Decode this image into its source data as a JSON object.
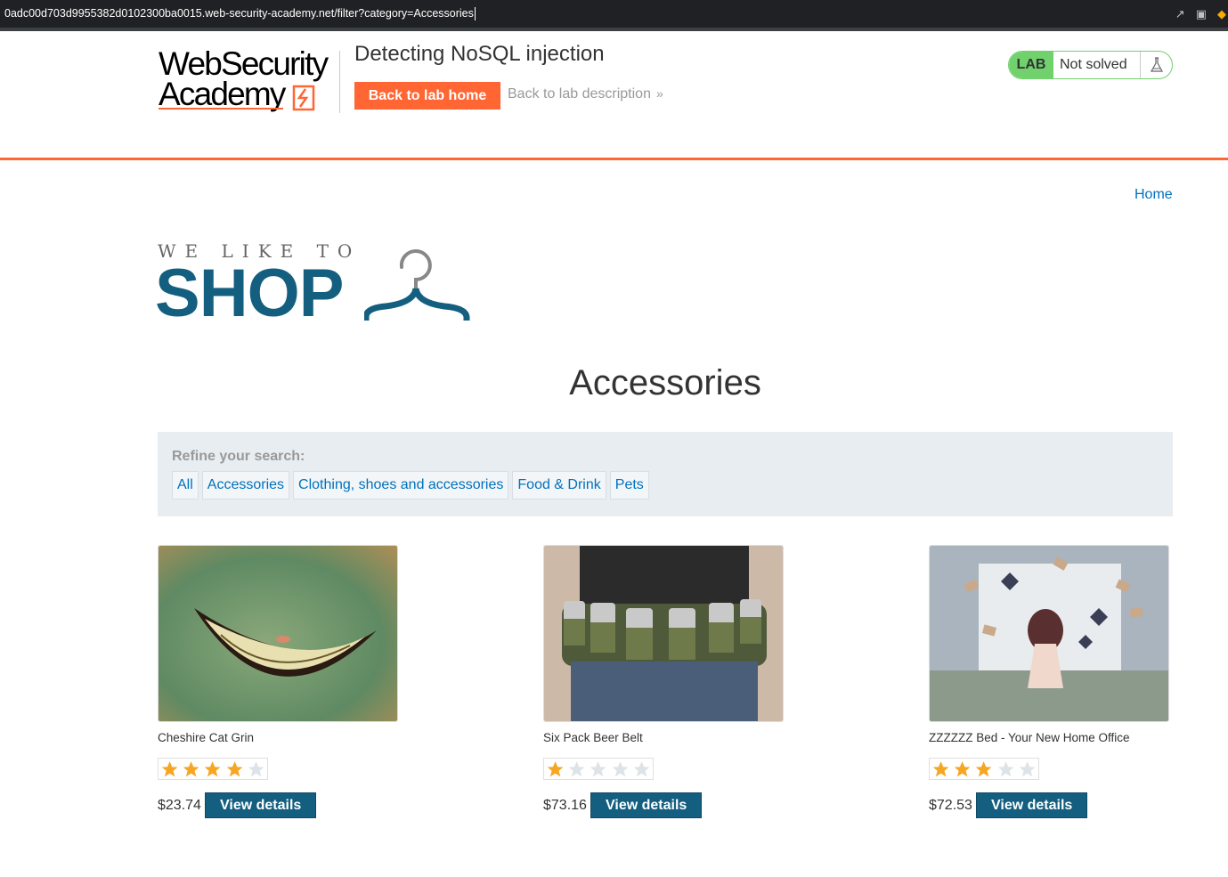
{
  "browser": {
    "url": "0adc00d703d9955382d0102300ba0015.web-security-academy.net/filter?category=Accessories"
  },
  "lab_header": {
    "logo_line1": "WebSecurity",
    "logo_line2": "Academy",
    "title": "Detecting NoSQL injection",
    "back_home_label": "Back to lab home",
    "back_desc_label": "Back to lab description",
    "lab_badge": "LAB",
    "status": "Not solved",
    "colors": {
      "accent": "#ff6633",
      "solved_green": "#70d16d"
    }
  },
  "nav": {
    "home_label": "Home"
  },
  "shop_logo": {
    "tagline": "WE LIKE TO",
    "word": "SHOP"
  },
  "page": {
    "heading": "Accessories"
  },
  "filter": {
    "label": "Refine your search:",
    "categories": [
      "All",
      "Accessories",
      "Clothing, shoes and accessories",
      "Food & Drink",
      "Pets"
    ]
  },
  "products": [
    {
      "name": "Cheshire Cat Grin",
      "rating": 4,
      "price": "$23.74",
      "button": "View details"
    },
    {
      "name": "Six Pack Beer Belt",
      "rating": 1,
      "price": "$73.16",
      "button": "View details"
    },
    {
      "name": "ZZZZZZ Bed - Your New Home Office",
      "rating": 3,
      "price": "$72.53",
      "button": "View details"
    }
  ],
  "icons": [
    "share-icon",
    "camera-icon",
    "shield-icon",
    "flask-icon",
    "chevron-double-right-icon",
    "hanger-icon",
    "star-icon"
  ],
  "colors": {
    "link": "#0071bc",
    "primary_button": "#145f80",
    "filter_bg": "#e8edf1",
    "star_filled": "#f5a623",
    "star_empty": "#dde3e6"
  }
}
